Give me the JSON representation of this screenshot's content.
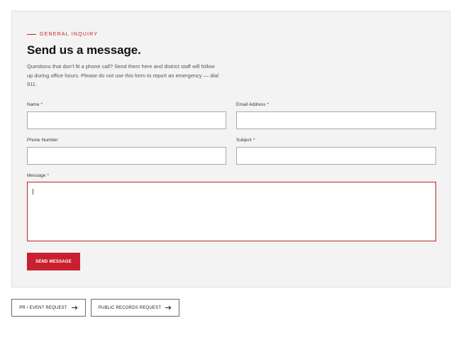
{
  "form": {
    "eyebrow": "GENERAL INQUIRY",
    "title": "Send us a message.",
    "intro": "Questions that don't fit a phone call? Send them here and district staff will follow up during office hours. Please do not use this form to report an emergency — dial 911.",
    "required_marker": "*",
    "fields": {
      "name": {
        "label": "Name",
        "required": true,
        "value": ""
      },
      "email": {
        "label": "Email Address",
        "required": true,
        "value": ""
      },
      "phone": {
        "label": "Phone Number",
        "required": false,
        "value": ""
      },
      "subject": {
        "label": "Subject",
        "required": true,
        "value": ""
      },
      "message": {
        "label": "Message",
        "required": true,
        "value": ""
      }
    },
    "submit_label": "SEND MESSAGE"
  },
  "links": {
    "pr_event": "PR / EVENT REQUEST",
    "public_records": "PUBLIC RECORDS REQUEST"
  },
  "colors": {
    "accent": "#c8202f",
    "panel_bg": "#f2f3f2"
  },
  "icons": {
    "link_arrow": "arrow-right-icon"
  }
}
